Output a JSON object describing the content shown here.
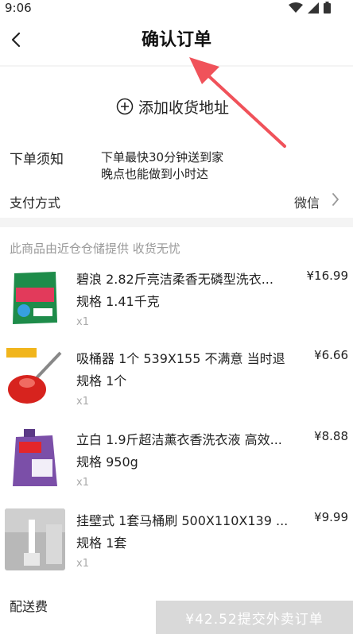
{
  "status": {
    "time": "9:06"
  },
  "header": {
    "title": "确认订单"
  },
  "address": {
    "add_label": "添加收货地址"
  },
  "notice": {
    "label": "下单须知",
    "line1": "下单最快30分钟送到家",
    "line2": "晚点也能做到小时达"
  },
  "payment": {
    "label": "支付方式",
    "value": "微信"
  },
  "products_section": {
    "source_text": "此商品由近仓仓储提供 收货无忧",
    "items": [
      {
        "name": "碧浪 2.82斤亮洁柔香无磷型洗衣...",
        "price": "¥16.99",
        "spec": "规格 1.41千克",
        "qty": "x1"
      },
      {
        "name": "吸桶器 1个 539X155 不满意 当时退",
        "price": "¥6.66",
        "spec": "规格 1个",
        "qty": "x1"
      },
      {
        "name": "立白 1.9斤超洁薰衣香洗衣液 高效...",
        "price": "¥8.88",
        "spec": "规格 950g",
        "qty": "x1"
      },
      {
        "name": "挂壁式 1套马桶刷 500X110X139 ...",
        "price": "¥9.99",
        "spec": "规格 1套",
        "qty": "x1"
      }
    ]
  },
  "footer": {
    "partial_text": "配送费",
    "submit_label": "¥42.52提交外卖订单"
  },
  "colors": {
    "accent_arrow": "#f0525a",
    "button_disabled": "#d9d9d9"
  }
}
